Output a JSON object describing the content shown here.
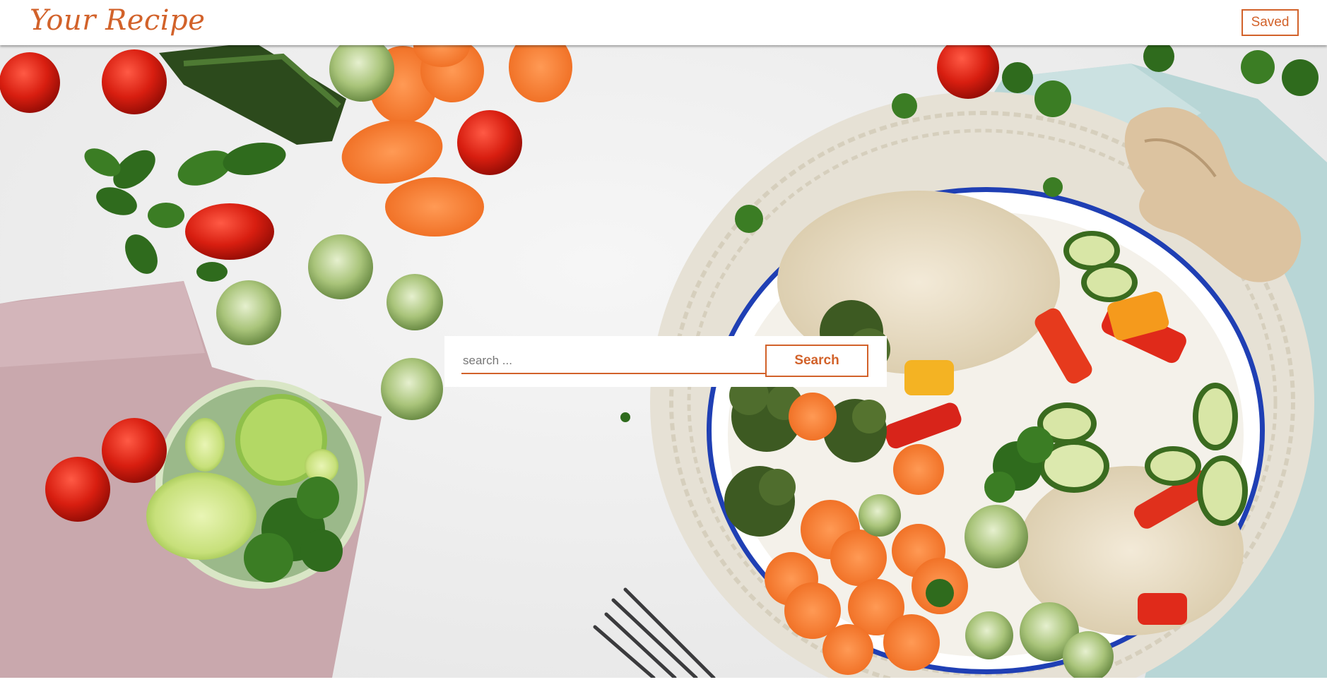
{
  "navbar": {
    "logo_text": "Your Recipe",
    "saved_label": "Saved"
  },
  "search": {
    "placeholder": "search ...",
    "value": "",
    "button_label": "Search"
  },
  "colors": {
    "accent": "#d2622a",
    "background": "#ececec"
  },
  "hero_image": {
    "icon": "food-background-image"
  }
}
